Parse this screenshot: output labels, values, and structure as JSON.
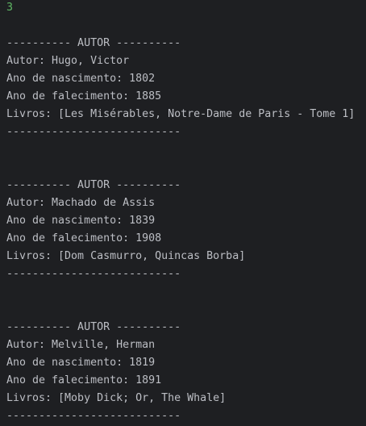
{
  "console": {
    "input_value": "3",
    "blocks": [
      {
        "header": "---------- AUTOR ----------",
        "author": "Autor: Hugo, Victor",
        "birth": "Ano de nascimento: 1802",
        "death": "Ano de falecimento: 1885",
        "books": "Livros: [Les Misérables, Notre-Dame de Paris - Tome 1]",
        "footer": "---------------------------"
      },
      {
        "header": "---------- AUTOR ----------",
        "author": "Autor: Machado de Assis",
        "birth": "Ano de nascimento: 1839",
        "death": "Ano de falecimento: 1908",
        "books": "Livros: [Dom Casmurro, Quincas Borba]",
        "footer": "---------------------------"
      },
      {
        "header": "---------- AUTOR ----------",
        "author": "Autor: Melville, Herman",
        "birth": "Ano de nascimento: 1819",
        "death": "Ano de falecimento: 1891",
        "books": "Livros: [Moby Dick; Or, The Whale]",
        "footer": "---------------------------"
      }
    ]
  },
  "colors": {
    "background": "#1e1f22",
    "text": "#bcbec4",
    "input": "#5fb865"
  }
}
